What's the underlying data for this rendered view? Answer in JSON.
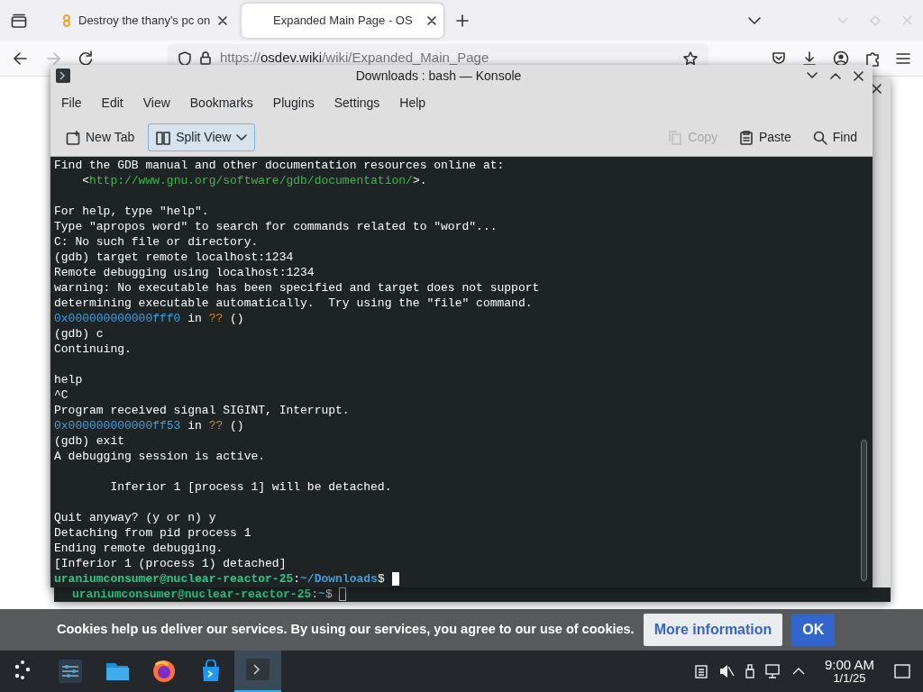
{
  "browser": {
    "tabs": [
      {
        "title": "Destroy the thany's pc on",
        "selected": false
      },
      {
        "title": "Expanded Main Page - OS",
        "selected": true
      }
    ],
    "nav_buttons": [
      {
        "kind": "back",
        "disabled": false
      },
      {
        "kind": "forward",
        "disabled": true
      },
      {
        "kind": "reload",
        "disabled": false
      }
    ],
    "url": {
      "scheme": "https://",
      "domain": "osdev.wiki",
      "path": "/wiki/Expanded_Main_Page"
    }
  },
  "back_window": {
    "prompt": [
      {
        "kind": "user",
        "text": "uraniumconsumer@nuclear-reactor-25"
      },
      {
        "kind": "plain",
        "text": ":"
      },
      {
        "kind": "path",
        "text": "~"
      },
      {
        "kind": "plain",
        "text": "$ "
      }
    ]
  },
  "konsole": {
    "title": "Downloads : bash — Konsole",
    "menu": [
      "File",
      "Edit",
      "View",
      "Bookmarks",
      "Plugins",
      "Settings",
      "Help"
    ],
    "toolbar": [
      {
        "kind": "new-tab",
        "label": "New Tab",
        "disabled": false,
        "focused": false
      },
      {
        "kind": "split-view",
        "label": "Split View",
        "disabled": false,
        "focused": true
      },
      {
        "kind": "copy",
        "label": "Copy",
        "disabled": true,
        "focused": false
      },
      {
        "kind": "paste",
        "label": "Paste",
        "disabled": false,
        "focused": false
      },
      {
        "kind": "find",
        "label": "Find",
        "disabled": false,
        "focused": false
      }
    ],
    "lines": [
      {
        "kind": "text",
        "segments": [
          {
            "kind": "plain",
            "text": "Find the GDB manual and other documentation resources online at:"
          }
        ]
      },
      {
        "kind": "text",
        "segments": [
          {
            "kind": "plain",
            "text": "    <"
          },
          {
            "kind": "link",
            "text": "http://www.gnu.org/software/gdb/documentation/"
          },
          {
            "kind": "plain",
            "text": ">."
          }
        ]
      },
      {
        "kind": "blank"
      },
      {
        "kind": "text",
        "segments": [
          {
            "kind": "plain",
            "text": "For help, type \"help\"."
          }
        ]
      },
      {
        "kind": "text",
        "segments": [
          {
            "kind": "plain",
            "text": "Type \"apropos word\" to search for commands related to \"word\"..."
          }
        ]
      },
      {
        "kind": "text",
        "segments": [
          {
            "kind": "plain",
            "text": "C: No such file or directory."
          }
        ]
      },
      {
        "kind": "text",
        "segments": [
          {
            "kind": "plain",
            "text": "(gdb) target remote localhost:1234"
          }
        ]
      },
      {
        "kind": "text",
        "segments": [
          {
            "kind": "plain",
            "text": "Remote debugging using localhost:1234"
          }
        ]
      },
      {
        "kind": "text",
        "segments": [
          {
            "kind": "plain",
            "text": "warning: No executable has been specified and target does not support"
          }
        ]
      },
      {
        "kind": "text",
        "segments": [
          {
            "kind": "plain",
            "text": "determining executable automatically.  Try using the \"file\" command."
          }
        ]
      },
      {
        "kind": "text",
        "segments": [
          {
            "kind": "address",
            "text": "0x000000000000fff0"
          },
          {
            "kind": "plain",
            "text": " in "
          },
          {
            "kind": "unknown",
            "text": "??"
          },
          {
            "kind": "plain",
            "text": " ()"
          }
        ]
      },
      {
        "kind": "text",
        "segments": [
          {
            "kind": "plain",
            "text": "(gdb) c"
          }
        ]
      },
      {
        "kind": "text",
        "segments": [
          {
            "kind": "plain",
            "text": "Continuing."
          }
        ]
      },
      {
        "kind": "blank"
      },
      {
        "kind": "text",
        "segments": [
          {
            "kind": "plain",
            "text": "help"
          }
        ]
      },
      {
        "kind": "text",
        "segments": [
          {
            "kind": "plain",
            "text": "^C"
          }
        ]
      },
      {
        "kind": "text",
        "segments": [
          {
            "kind": "plain",
            "text": "Program received signal SIGINT, Interrupt."
          }
        ]
      },
      {
        "kind": "text",
        "segments": [
          {
            "kind": "address",
            "text": "0x000000000000ff53"
          },
          {
            "kind": "plain",
            "text": " in "
          },
          {
            "kind": "unknown",
            "text": "??"
          },
          {
            "kind": "plain",
            "text": " ()"
          }
        ]
      },
      {
        "kind": "text",
        "segments": [
          {
            "kind": "plain",
            "text": "(gdb) exit"
          }
        ]
      },
      {
        "kind": "text",
        "segments": [
          {
            "kind": "plain",
            "text": "A debugging session is active."
          }
        ]
      },
      {
        "kind": "blank"
      },
      {
        "kind": "text",
        "segments": [
          {
            "kind": "plain",
            "text": "        Inferior 1 [process 1] will be detached."
          }
        ]
      },
      {
        "kind": "blank"
      },
      {
        "kind": "text",
        "segments": [
          {
            "kind": "plain",
            "text": "Quit anyway? (y or n) y"
          }
        ]
      },
      {
        "kind": "text",
        "segments": [
          {
            "kind": "plain",
            "text": "Detaching from pid process 1"
          }
        ]
      },
      {
        "kind": "text",
        "segments": [
          {
            "kind": "plain",
            "text": "Ending remote debugging."
          }
        ]
      },
      {
        "kind": "text",
        "segments": [
          {
            "kind": "plain",
            "text": "[Inferior 1 (process 1) detached]"
          }
        ]
      },
      {
        "kind": "prompt",
        "segments": [
          {
            "kind": "user",
            "text": "uraniumconsumer@nuclear-reactor-25"
          },
          {
            "kind": "plain",
            "text": ":"
          },
          {
            "kind": "path",
            "text": "~/Downloads"
          },
          {
            "kind": "plain",
            "text": "$ "
          }
        ]
      }
    ]
  },
  "cookie_notice": {
    "text": "Cookies help us deliver our services. By using our services, you agree to our use of cookies.",
    "buttons": [
      {
        "kind": "secondary",
        "label": "More information"
      },
      {
        "kind": "primary",
        "label": "OK"
      }
    ]
  },
  "taskbar": {
    "apps": [
      {
        "kind": "launcher",
        "active": false
      },
      {
        "kind": "settings",
        "active": false
      },
      {
        "kind": "files",
        "active": false
      },
      {
        "kind": "browser",
        "active": false
      },
      {
        "kind": "store",
        "active": false
      },
      {
        "kind": "terminal",
        "active": true
      }
    ],
    "clock": {
      "time": "9:00 AM",
      "date": "1/1/25"
    }
  }
}
